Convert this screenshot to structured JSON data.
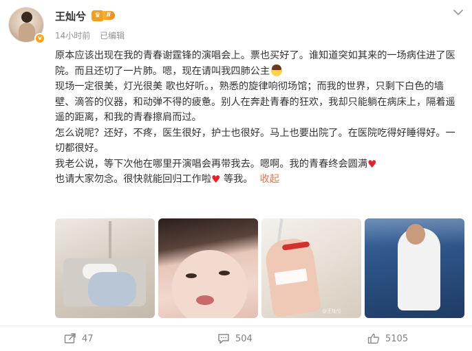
{
  "author": {
    "name": "王灿兮",
    "membership_level": "Ⅱ",
    "verified_badge": "v",
    "post_time": "14小时前",
    "edited_label": "已编辑"
  },
  "post": {
    "paragraphs": [
      "原本应该出现在我的青春谢霆锋的演唱会上。票也买好了。谁知道突如其来的一场病住进了医院。而且还切了一片肺。嗯，现在请叫我四肺公主",
      "现场一定很美，灯光很美 歌也好听。，熟悉的旋律响彻场馆；而我的世界，只剩下白色的墙壁、滴答的仪器，和动弹不得的疲惫。别人在奔赴青春的狂欢，我却只能躺在病床上，隔着遥遥的距离，和我的青春擦肩而过。",
      "怎么说呢？还好，不疼，医生很好，护士也很好。马上也要出院了。在医院吃得好睡得好。一切都很好。",
      "我老公说，等下次他在哪里开演唱会再带我去。嗯啊。我的青春终会圆满",
      "也请大家勿念。很快就能回归工作啦"
    ],
    "last_line_suffix": " 等我。",
    "collapse_label": "收起",
    "heart_emoji": "♥",
    "photo_watermark": "@王灿兮"
  },
  "photos": [
    {
      "name": "hospital-bed-photo"
    },
    {
      "name": "selfie-photo"
    },
    {
      "name": "iv-hand-photo"
    },
    {
      "name": "concert-photo"
    }
  ],
  "actions": {
    "repost_count": "47",
    "comment_count": "504",
    "like_count": "5105"
  },
  "icons": {
    "more": "chevron-down-icon",
    "repost": "repost-icon",
    "comment": "comment-icon",
    "like": "thumbs-up-icon"
  },
  "colors": {
    "accent": "#eb7350",
    "heart": "#e8202a",
    "meta": "#939393",
    "action": "#808080"
  }
}
